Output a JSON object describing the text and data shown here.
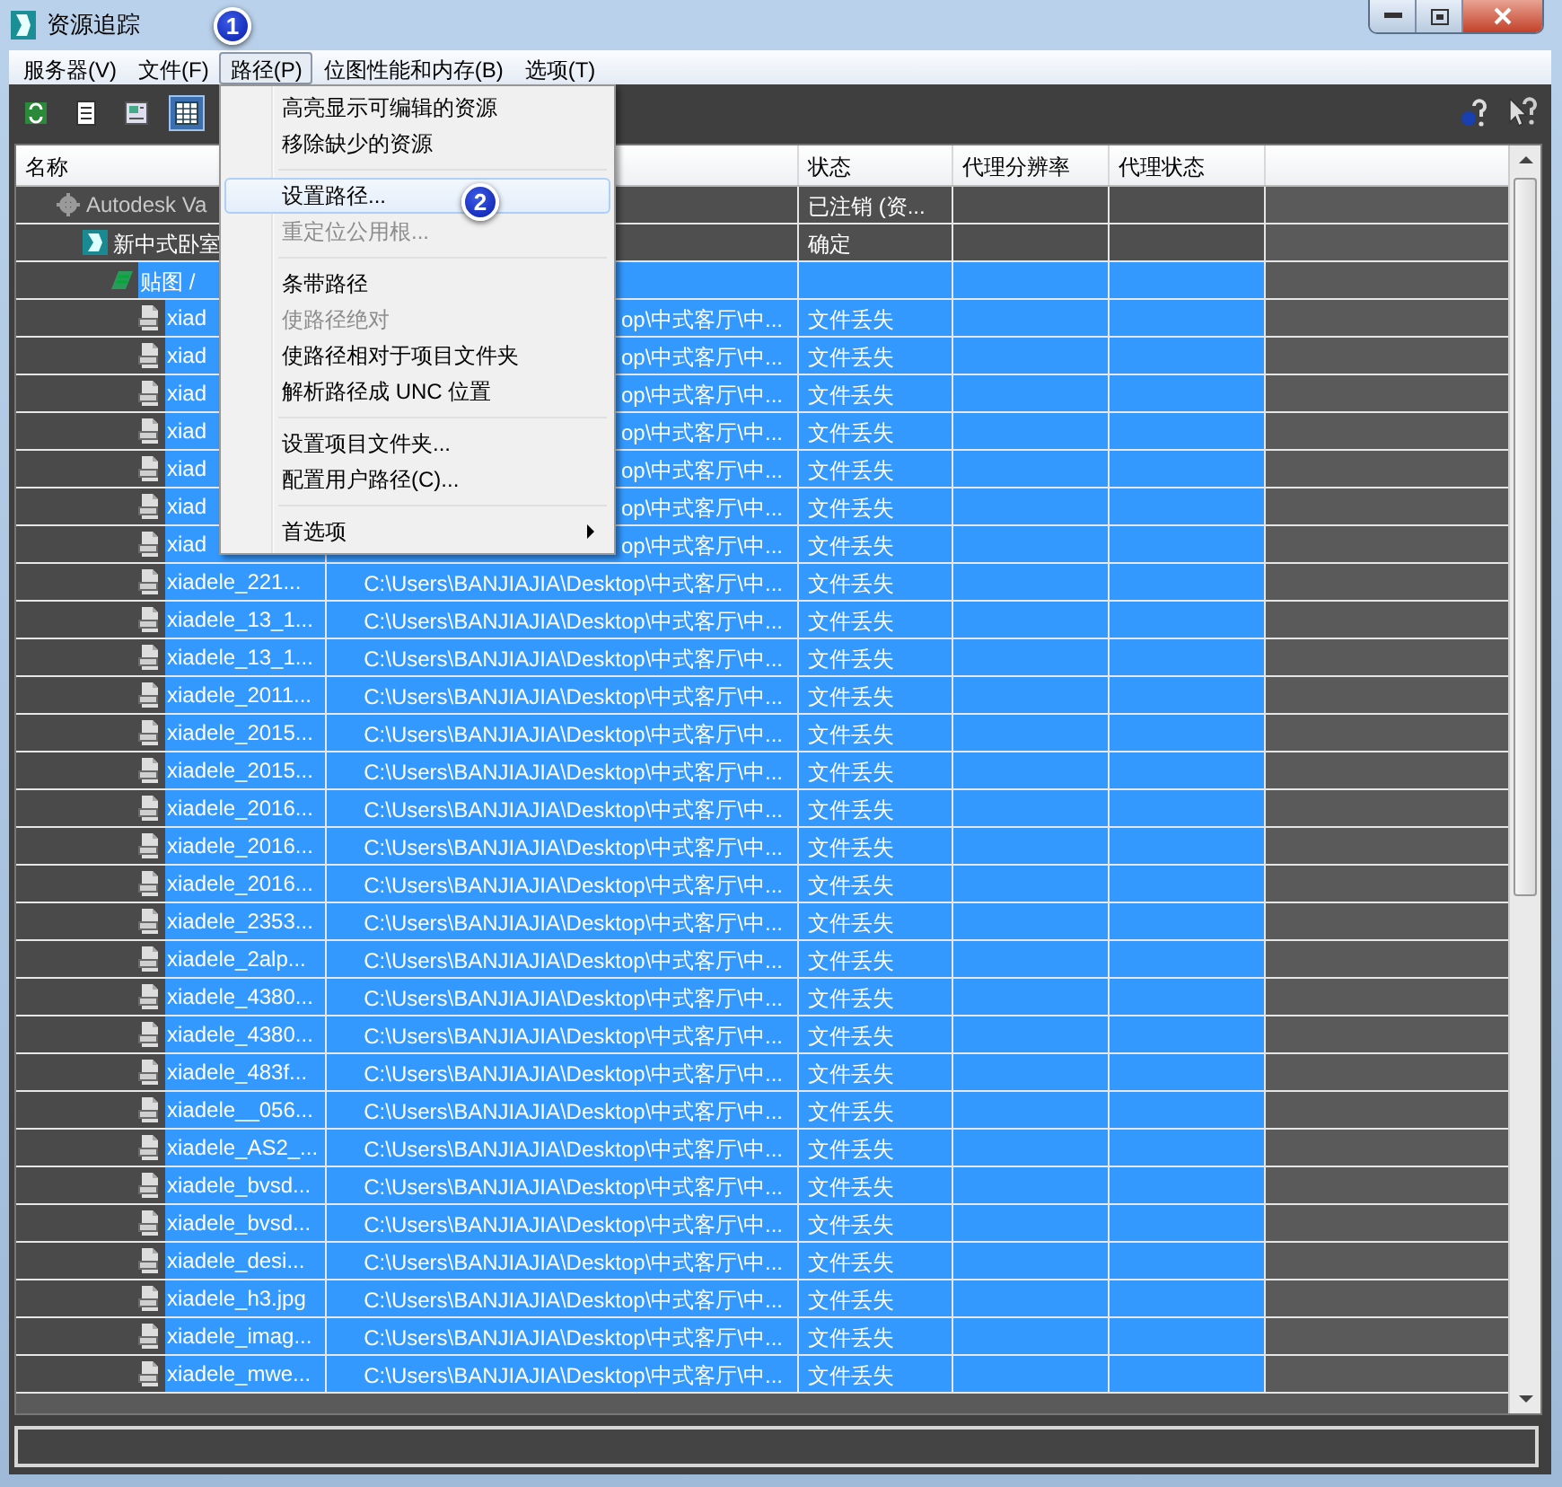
{
  "window": {
    "title": "资源追踪"
  },
  "menu_bar": [
    {
      "label": "服务器(V)",
      "selected": false
    },
    {
      "label": "文件(F)",
      "selected": false
    },
    {
      "label": "路径(P)",
      "selected": true
    },
    {
      "label": "位图性能和内存(B)",
      "selected": false
    },
    {
      "label": "选项(T)",
      "selected": false
    }
  ],
  "toolbar": [
    {
      "kind": "refresh",
      "selected": false
    },
    {
      "kind": "list",
      "selected": false
    },
    {
      "kind": "thumbnail",
      "selected": false
    },
    {
      "kind": "table",
      "selected": true
    }
  ],
  "table": {
    "columns": [
      "名称",
      "状态",
      "代理分辨率",
      "代理状态"
    ],
    "rows": [
      {
        "kind": "vault",
        "name": "Autodesk Va",
        "status": "已注销 (资...",
        "selected": false,
        "children": [
          {
            "kind": "scene",
            "name": "新中式卧室",
            "status": "确定",
            "selected": false,
            "children": [
              {
                "kind": "maps",
                "name": "贴图 /",
                "selected": true,
                "children": [
                  {
                    "kind": "file",
                    "name": "xiad",
                    "path": "op\\中式客厅\\中...",
                    "status": "文件丢失",
                    "selected": true
                  },
                  {
                    "kind": "file",
                    "name": "xiad",
                    "path": "op\\中式客厅\\中...",
                    "status": "文件丢失",
                    "selected": true
                  },
                  {
                    "kind": "file",
                    "name": "xiad",
                    "path": "op\\中式客厅\\中...",
                    "status": "文件丢失",
                    "selected": true
                  },
                  {
                    "kind": "file",
                    "name": "xiad",
                    "path": "op\\中式客厅\\中...",
                    "status": "文件丢失",
                    "selected": true
                  },
                  {
                    "kind": "file",
                    "name": "xiad",
                    "path": "op\\中式客厅\\中...",
                    "status": "文件丢失",
                    "selected": true
                  },
                  {
                    "kind": "file",
                    "name": "xiad",
                    "path": "op\\中式客厅\\中...",
                    "status": "文件丢失",
                    "selected": true
                  },
                  {
                    "kind": "file",
                    "name": "xiad",
                    "path": "op\\中式客厅\\中...",
                    "status": "文件丢失",
                    "selected": true
                  },
                  {
                    "kind": "file",
                    "name": "xiadele_221...",
                    "path": "C:\\Users\\BANJIAJIA\\Desktop\\中式客厅\\中...",
                    "status": "文件丢失",
                    "selected": true
                  },
                  {
                    "kind": "file",
                    "name": "xiadele_13_1...",
                    "path": "C:\\Users\\BANJIAJIA\\Desktop\\中式客厅\\中...",
                    "status": "文件丢失",
                    "selected": true
                  },
                  {
                    "kind": "file",
                    "name": "xiadele_13_1...",
                    "path": "C:\\Users\\BANJIAJIA\\Desktop\\中式客厅\\中...",
                    "status": "文件丢失",
                    "selected": true
                  },
                  {
                    "kind": "file",
                    "name": "xiadele_2011...",
                    "path": "C:\\Users\\BANJIAJIA\\Desktop\\中式客厅\\中...",
                    "status": "文件丢失",
                    "selected": true
                  },
                  {
                    "kind": "file",
                    "name": "xiadele_2015...",
                    "path": "C:\\Users\\BANJIAJIA\\Desktop\\中式客厅\\中...",
                    "status": "文件丢失",
                    "selected": true
                  },
                  {
                    "kind": "file",
                    "name": "xiadele_2015...",
                    "path": "C:\\Users\\BANJIAJIA\\Desktop\\中式客厅\\中...",
                    "status": "文件丢失",
                    "selected": true
                  },
                  {
                    "kind": "file",
                    "name": "xiadele_2016...",
                    "path": "C:\\Users\\BANJIAJIA\\Desktop\\中式客厅\\中...",
                    "status": "文件丢失",
                    "selected": true
                  },
                  {
                    "kind": "file",
                    "name": "xiadele_2016...",
                    "path": "C:\\Users\\BANJIAJIA\\Desktop\\中式客厅\\中...",
                    "status": "文件丢失",
                    "selected": true
                  },
                  {
                    "kind": "file",
                    "name": "xiadele_2016...",
                    "path": "C:\\Users\\BANJIAJIA\\Desktop\\中式客厅\\中...",
                    "status": "文件丢失",
                    "selected": true
                  },
                  {
                    "kind": "file",
                    "name": "xiadele_2353...",
                    "path": "C:\\Users\\BANJIAJIA\\Desktop\\中式客厅\\中...",
                    "status": "文件丢失",
                    "selected": true
                  },
                  {
                    "kind": "file",
                    "name": "xiadele_2alp...",
                    "path": "C:\\Users\\BANJIAJIA\\Desktop\\中式客厅\\中...",
                    "status": "文件丢失",
                    "selected": true
                  },
                  {
                    "kind": "file",
                    "name": "xiadele_4380...",
                    "path": "C:\\Users\\BANJIAJIA\\Desktop\\中式客厅\\中...",
                    "status": "文件丢失",
                    "selected": true
                  },
                  {
                    "kind": "file",
                    "name": "xiadele_4380...",
                    "path": "C:\\Users\\BANJIAJIA\\Desktop\\中式客厅\\中...",
                    "status": "文件丢失",
                    "selected": true
                  },
                  {
                    "kind": "file",
                    "name": "xiadele_483f...",
                    "path": "C:\\Users\\BANJIAJIA\\Desktop\\中式客厅\\中...",
                    "status": "文件丢失",
                    "selected": true
                  },
                  {
                    "kind": "file",
                    "name": "xiadele__056...",
                    "path": "C:\\Users\\BANJIAJIA\\Desktop\\中式客厅\\中...",
                    "status": "文件丢失",
                    "selected": true
                  },
                  {
                    "kind": "file",
                    "name": "xiadele_AS2_...",
                    "path": "C:\\Users\\BANJIAJIA\\Desktop\\中式客厅\\中...",
                    "status": "文件丢失",
                    "selected": true
                  },
                  {
                    "kind": "file",
                    "name": "xiadele_bvsd...",
                    "path": "C:\\Users\\BANJIAJIA\\Desktop\\中式客厅\\中...",
                    "status": "文件丢失",
                    "selected": true
                  },
                  {
                    "kind": "file",
                    "name": "xiadele_bvsd...",
                    "path": "C:\\Users\\BANJIAJIA\\Desktop\\中式客厅\\中...",
                    "status": "文件丢失",
                    "selected": true
                  },
                  {
                    "kind": "file",
                    "name": "xiadele_desi...",
                    "path": "C:\\Users\\BANJIAJIA\\Desktop\\中式客厅\\中...",
                    "status": "文件丢失",
                    "selected": true
                  },
                  {
                    "kind": "file",
                    "name": "xiadele_h3.jpg",
                    "path": "C:\\Users\\BANJIAJIA\\Desktop\\中式客厅\\中...",
                    "status": "文件丢失",
                    "selected": true
                  },
                  {
                    "kind": "file",
                    "name": "xiadele_imag...",
                    "path": "C:\\Users\\BANJIAJIA\\Desktop\\中式客厅\\中...",
                    "status": "文件丢失",
                    "selected": true
                  },
                  {
                    "kind": "file",
                    "name": "xiadele_mwe...",
                    "path": "C:\\Users\\BANJIAJIA\\Desktop\\中式客厅\\中...",
                    "status": "文件丢失",
                    "selected": true
                  }
                ]
              }
            ]
          }
        ]
      }
    ]
  },
  "path_menu": {
    "groups": [
      [
        {
          "label": "高亮显示可编辑的资源",
          "disabled": false,
          "selected": false,
          "submenu": false
        },
        {
          "label": "移除缺少的资源",
          "disabled": false,
          "selected": false,
          "submenu": false
        }
      ],
      [
        {
          "label": "设置路径...",
          "disabled": false,
          "selected": true,
          "submenu": false
        },
        {
          "label": "重定位公用根...",
          "disabled": true,
          "selected": false,
          "submenu": false
        }
      ],
      [
        {
          "label": "条带路径",
          "disabled": false,
          "selected": false,
          "submenu": false
        },
        {
          "label": "使路径绝对",
          "disabled": true,
          "selected": false,
          "submenu": false
        },
        {
          "label": "使路径相对于项目文件夹",
          "disabled": false,
          "selected": false,
          "submenu": false
        },
        {
          "label": "解析路径成 UNC 位置",
          "disabled": false,
          "selected": false,
          "submenu": false
        }
      ],
      [
        {
          "label": "设置项目文件夹...",
          "disabled": false,
          "selected": false,
          "submenu": false
        },
        {
          "label": "配置用户路径(C)...",
          "disabled": false,
          "selected": false,
          "submenu": false
        }
      ],
      [
        {
          "label": "首选项",
          "disabled": false,
          "selected": false,
          "submenu": true
        }
      ]
    ]
  },
  "callouts": [
    "1",
    "2"
  ]
}
